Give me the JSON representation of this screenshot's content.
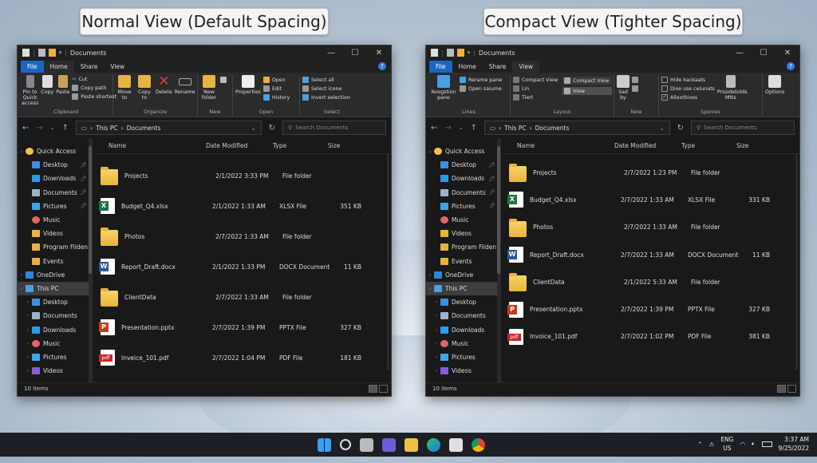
{
  "left_caption": "Normal View (Default Spacing)",
  "right_caption": "Compact View (Tighter Spacing)",
  "window_title": "Documents",
  "left": {
    "tabs": [
      "File",
      "Home",
      "Share",
      "View"
    ],
    "active_tab": "Home",
    "ribbon": {
      "pin": "Pin to Quick access",
      "copy": "Copy",
      "paste": "Paste",
      "cut": "Cut",
      "copy_path": "Copy path",
      "paste_shortcut": "Paste shartest",
      "move_to": "Move to",
      "copy_to": "Copy to",
      "delete": "Delete",
      "rename": "Rename",
      "new_folder": "New folder",
      "properties": "Properties",
      "open": "Open",
      "edit": "Edit",
      "history": "History",
      "select_all": "Select all",
      "select_none": "Select icone",
      "invert": "Invert selection",
      "groups": [
        "Clipboard",
        "Organize",
        "New",
        "Open",
        "Select"
      ]
    },
    "path": [
      "This PC",
      "Documents"
    ],
    "search_placeholder": "Search Documents",
    "columns": [
      "Name",
      "Date Modified",
      "Type",
      "Size"
    ],
    "files": [
      {
        "icon": "folder",
        "name": "Projects",
        "date": "2/1/2022 3:33 PM",
        "type": "File folder",
        "size": ""
      },
      {
        "icon": "xlsx",
        "name": "Budget_Q4.xlsx",
        "date": "2/1/2022 1:33 AM",
        "type": "XLSX File",
        "size": "351 KB"
      },
      {
        "icon": "folder",
        "name": "Photos",
        "date": "2/7/2022 1:33 AM",
        "type": "File folder",
        "size": ""
      },
      {
        "icon": "docx",
        "name": "Report_Draft.docx",
        "date": "2/1/2022 1:33 PM",
        "type": "DOCX Document",
        "size": "11 KB"
      },
      {
        "icon": "folder",
        "name": "ClientData",
        "date": "2/7/2022 1:33 AM",
        "type": "File folder",
        "size": ""
      },
      {
        "icon": "pptx",
        "name": "Presentation.pptx",
        "date": "2/7/2022 1:39 PM",
        "type": "PPTX File",
        "size": "327 KB"
      },
      {
        "icon": "pdf",
        "name": "Inveice_101.pdf",
        "date": "2/7/2022 1:04 PM",
        "type": "PDF File",
        "size": "181 KB"
      }
    ],
    "status": "10 items"
  },
  "right": {
    "tabs": [
      "File",
      "Home",
      "Share",
      "View"
    ],
    "active_tab": "View",
    "ribbon": {
      "nav_pane": "Nosgstion pane",
      "preview_pane": "Rerame pane",
      "open_column": "Open saiume",
      "compact_view": "Compact View",
      "lin": "Lin",
      "tiert": "Tiert",
      "compact_view2": "Compact View",
      "view": "View",
      "sort_by": "Sad by",
      "hide_checkboxes": "Hide kackaats",
      "dixe": "Dixe use celunats",
      "allext": "Allexthixes",
      "pres": "Prssidetolds Mtts",
      "options": "Options",
      "groups": [
        "Lines",
        "Layout",
        "New",
        "Spsnies"
      ]
    },
    "path": [
      "This PC",
      "Documents"
    ],
    "search_placeholder": "Search Documents",
    "columns": [
      "Name",
      "Date Modified",
      "Type",
      "Size"
    ],
    "files": [
      {
        "icon": "folder",
        "name": "Projects",
        "date": "2/7/2022 1:23 PM",
        "type": "File folder",
        "size": ""
      },
      {
        "icon": "xlsx",
        "name": "Budget_Q4.xlsx",
        "date": "2/7/2022 1:33 AM",
        "type": "XLSX File",
        "size": "331 KB"
      },
      {
        "icon": "folder",
        "name": "Photos",
        "date": "2/7/2022 1:33 AM",
        "type": "File folder",
        "size": ""
      },
      {
        "icon": "docx",
        "name": "Report_Draft.docx",
        "date": "2/7/2022 1:33 AM",
        "type": "DOCX Document",
        "size": "11 KB"
      },
      {
        "icon": "folder",
        "name": "ClientData",
        "date": "2/1/2022 5:33 AM",
        "type": "File folder",
        "size": ""
      },
      {
        "icon": "pptx",
        "name": "Presentation.pptx",
        "date": "2/7/2022 1:39 PM",
        "type": "PPTX File",
        "size": "327 KB"
      },
      {
        "icon": "pdf",
        "name": "Invoice_101.pdf",
        "date": "2/7/2022 1:02 PM",
        "type": "PDF File",
        "size": "381 KB"
      }
    ],
    "status": "10 items"
  },
  "nav": [
    {
      "label": "Quick Access",
      "icon": "star",
      "level": 0,
      "chev": "v",
      "pin": false
    },
    {
      "label": "Desktop",
      "icon": "desktop",
      "level": 1,
      "chev": "",
      "pin": true
    },
    {
      "label": "Downloads",
      "icon": "download",
      "level": 1,
      "chev": "",
      "pin": true
    },
    {
      "label": "Documents",
      "icon": "documents",
      "level": 1,
      "chev": "",
      "pin": true
    },
    {
      "label": "Pictures",
      "icon": "pictures",
      "level": 1,
      "chev": "",
      "pin": true
    },
    {
      "label": "Music",
      "icon": "music",
      "level": 1,
      "chev": "",
      "pin": false
    },
    {
      "label": "Videos",
      "icon": "folder",
      "level": 1,
      "chev": "",
      "pin": false
    },
    {
      "label": "Program Filden",
      "icon": "folder",
      "level": 1,
      "chev": "",
      "pin": false
    },
    {
      "label": "Events",
      "icon": "folder",
      "level": 1,
      "chev": "",
      "pin": false
    },
    {
      "label": "OneDrive",
      "icon": "cloud",
      "level": 0,
      "chev": ">",
      "pin": false
    },
    {
      "label": "This PC",
      "icon": "pc",
      "level": 0,
      "chev": "v",
      "pin": false,
      "selected": true
    },
    {
      "label": "Desktop",
      "icon": "desktop",
      "level": 1,
      "chev": ">",
      "pin": false
    },
    {
      "label": "Documents",
      "icon": "documents",
      "level": 1,
      "chev": ">",
      "pin": false
    },
    {
      "label": "Downloads",
      "icon": "download",
      "level": 1,
      "chev": ">",
      "pin": false
    },
    {
      "label": "Music",
      "icon": "music",
      "level": 1,
      "chev": ">",
      "pin": false
    },
    {
      "label": "Pictures",
      "icon": "pictures",
      "level": 1,
      "chev": ">",
      "pin": false
    },
    {
      "label": "Videos",
      "icon": "videos",
      "level": 1,
      "chev": ">",
      "pin": false
    }
  ],
  "tray": {
    "lang1": "ENG",
    "lang2": "US",
    "time": "3:37 AM",
    "date": "9/25/2022"
  }
}
